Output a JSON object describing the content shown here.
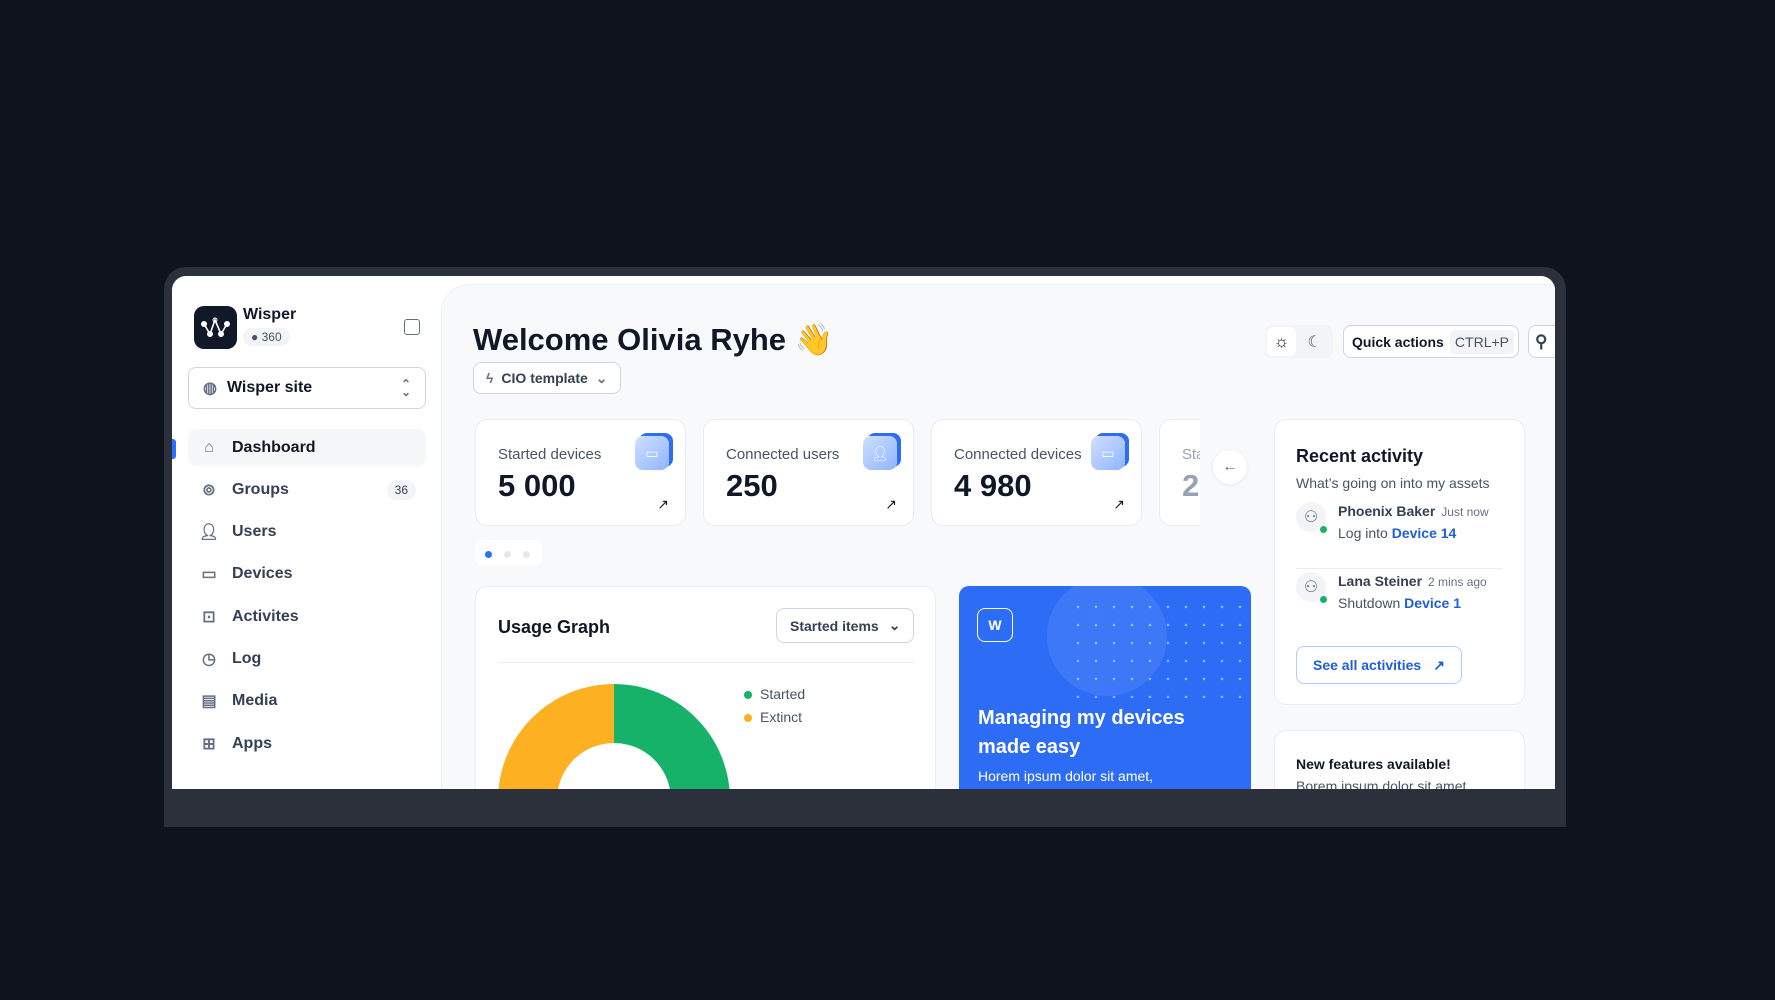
{
  "app": {
    "name": "Wisper",
    "count": "360"
  },
  "site_selector": {
    "value": "Wisper site"
  },
  "sidebar": {
    "items": [
      {
        "label": "Dashboard",
        "icon": "home-icon",
        "active": true
      },
      {
        "label": "Groups",
        "icon": "groups-icon",
        "count": "36"
      },
      {
        "label": "Users",
        "icon": "users-icon"
      },
      {
        "label": "Devices",
        "icon": "monitor-icon"
      },
      {
        "label": "Activites",
        "icon": "activities-icon"
      },
      {
        "label": "Log",
        "icon": "clock-icon"
      },
      {
        "label": "Media",
        "icon": "media-icon"
      },
      {
        "label": "Apps",
        "icon": "apps-grid-icon"
      }
    ]
  },
  "header": {
    "title": "Welcome Olivia Ryhe",
    "emoji": "👋",
    "template": "CIO template",
    "quick_actions": "Quick actions",
    "shortcut": "CTRL+P",
    "search_shortcut": "/"
  },
  "stats": [
    {
      "label": "Started devices",
      "value": "5 000",
      "icon": "monitor-icon"
    },
    {
      "label": "Connected users",
      "value": "250",
      "icon": "users-icon"
    },
    {
      "label": "Connected devices",
      "value": "4 980",
      "icon": "monitor-icon"
    },
    {
      "label": "Sta",
      "value": "2"
    }
  ],
  "carousel": {
    "pages": 3,
    "current": 1
  },
  "usage": {
    "title": "Usage Graph",
    "filter": "Started items"
  },
  "chart_data": {
    "type": "pie",
    "donut": true,
    "categories": [
      "Started",
      "Extinct"
    ],
    "values": [
      29,
      71
    ],
    "colors": [
      "#17b26a",
      "#fdb022"
    ]
  },
  "promo": {
    "title": "Managing my devices made easy",
    "body": "Horem ipsum dolor sit amet,"
  },
  "recent": {
    "title": "Recent activity",
    "subtitle": "What’s going on into my assets",
    "items": [
      {
        "name": "Phoenix Baker",
        "time": "Just now",
        "action": "Log into",
        "target": "Device 14"
      },
      {
        "name": "Lana Steiner",
        "time": "2 mins ago",
        "action": "Shutdown",
        "target": "Device 1"
      }
    ],
    "see_all": "See all activities"
  },
  "features": {
    "title": "New features available!",
    "body": "Borem ipsum dolor sit amet,"
  },
  "colors": {
    "accent": "#2970ff",
    "promo_bg": "#2d6df6",
    "online": "#17b26a"
  }
}
